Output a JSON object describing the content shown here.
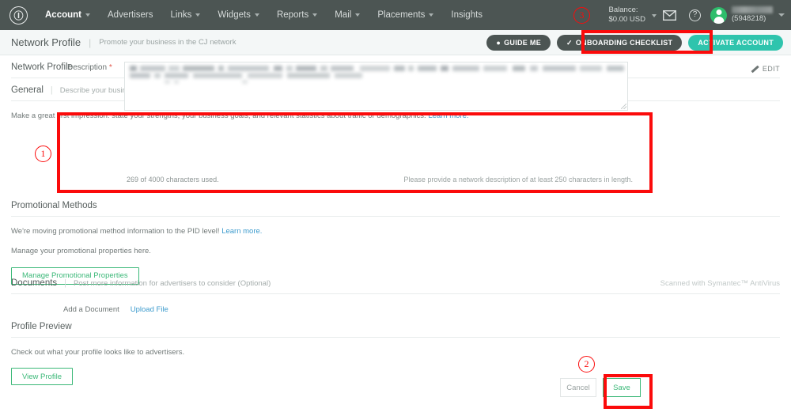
{
  "topnav": {
    "logo_alt": "CJ",
    "items": [
      {
        "label": "Account",
        "has_caret": true,
        "active": true
      },
      {
        "label": "Advertisers",
        "has_caret": false,
        "active": false
      },
      {
        "label": "Links",
        "has_caret": true,
        "active": false
      },
      {
        "label": "Widgets",
        "has_caret": true,
        "active": false
      },
      {
        "label": "Reports",
        "has_caret": true,
        "active": false
      },
      {
        "label": "Mail",
        "has_caret": true,
        "active": false
      },
      {
        "label": "Placements",
        "has_caret": true,
        "active": false
      },
      {
        "label": "Insights",
        "has_caret": false,
        "active": false
      }
    ],
    "balance_label": "Balance:",
    "balance_value": "$0.00 USD",
    "mail_icon": "envelope-icon",
    "help_icon": "question-mark-icon",
    "avatar_icon": "user-avatar-icon",
    "user_id": "(5948218)"
  },
  "subheader": {
    "title": "Network Profile",
    "divider": "|",
    "subtitle": "Promote your business in the CJ network",
    "guide_me": "GUIDE ME",
    "guide_me_icon": "map-pin-icon",
    "onboarding": "ONBOARDING CHECKLIST",
    "onboarding_icon": "check-icon",
    "activate": "ACTIVATE ACCOUNT"
  },
  "page": {
    "section_title": "Network Profile",
    "edit_label": "EDIT",
    "edit_icon": "pencil-icon"
  },
  "general": {
    "title": "General",
    "divider": "|",
    "desc": "Describe your business model",
    "intro": "Make a great first impression: state your strengths, your business goals, and relevant statistics about traffic or demographics.",
    "intro_link": "Learn more.",
    "field_label": "Description",
    "required_mark": "*",
    "textarea_value": "",
    "char_counter": "269 of 4000 characters used.",
    "hint": "Please provide a network description of at least 250 characters in length."
  },
  "promotional": {
    "title": "Promotional Methods",
    "line1": "We're moving promotional method information to the PID level!",
    "line1_link": "Learn more.",
    "line2": "Manage your promotional properties here.",
    "button": "Manage Promotional Properties"
  },
  "documents": {
    "title": "Documents",
    "divider": "|",
    "desc": "Post more information for advertisers to consider (Optional)",
    "scanned_note": "Scanned with Symantec™ AntiVirus",
    "add_label": "Add a Document",
    "upload_link": "Upload File"
  },
  "preview": {
    "title": "Profile Preview",
    "desc": "Check out what your profile looks like to advertisers.",
    "button": "View Profile"
  },
  "footer": {
    "cancel": "Cancel",
    "save": "Save"
  },
  "annotations": {
    "marker1": "1",
    "marker2": "2",
    "marker3": "3",
    "color": "#fb0b0b"
  }
}
